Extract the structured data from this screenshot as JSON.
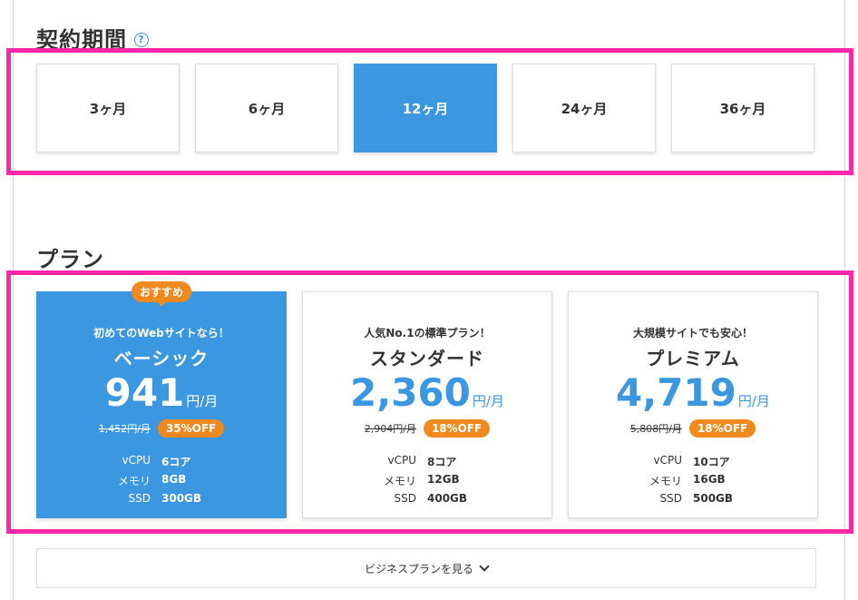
{
  "contract": {
    "title": "契約期間",
    "help_icon": "?",
    "terms": [
      {
        "label": "3ヶ月",
        "selected": false
      },
      {
        "label": "6ヶ月",
        "selected": false
      },
      {
        "label": "12ヶ月",
        "selected": true
      },
      {
        "label": "24ヶ月",
        "selected": false
      },
      {
        "label": "36ヶ月",
        "selected": false
      }
    ]
  },
  "plans": {
    "title": "プラン",
    "items": [
      {
        "badge": "おすすめ",
        "subtitle": "初めてのWebサイトなら！",
        "name": "ベーシック",
        "price": "941",
        "unit": "円/月",
        "old_price": "1,452円/月",
        "discount": "35%OFF",
        "specs": [
          {
            "label": "vCPU",
            "value": "6コア"
          },
          {
            "label": "メモリ",
            "value": "8GB"
          },
          {
            "label": "SSD",
            "value": "300GB"
          }
        ]
      },
      {
        "subtitle": "人気No.1の標準プラン！",
        "name": "スタンダード",
        "price": "2,360",
        "unit": "円/月",
        "old_price": "2,904円/月",
        "discount": "18%OFF",
        "specs": [
          {
            "label": "vCPU",
            "value": "8コア"
          },
          {
            "label": "メモリ",
            "value": "12GB"
          },
          {
            "label": "SSD",
            "value": "400GB"
          }
        ]
      },
      {
        "subtitle": "大規模サイトでも安心！",
        "name": "プレミアム",
        "price": "4,719",
        "unit": "円/月",
        "old_price": "5,808円/月",
        "discount": "18%OFF",
        "specs": [
          {
            "label": "vCPU",
            "value": "10コア"
          },
          {
            "label": "メモリ",
            "value": "16GB"
          },
          {
            "label": "SSD",
            "value": "500GB"
          }
        ]
      }
    ]
  },
  "more_button": {
    "label": "ビジネスプランを見る",
    "icon": "chevron-down-icon"
  },
  "colors": {
    "accent": "#3a97e0",
    "badge": "#f08a1e",
    "highlight": "#ff27a8"
  }
}
